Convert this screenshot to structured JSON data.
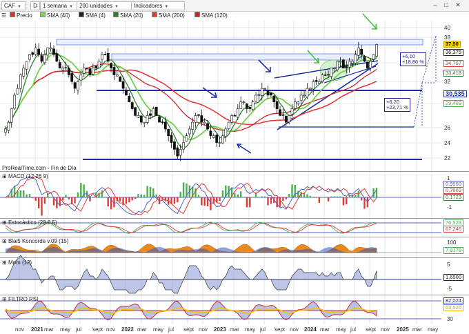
{
  "toolbar": {
    "symbol": "CAF",
    "mode_letter": "D",
    "period": "1 semana",
    "units": "200 unidades",
    "indicators": "Indicadores"
  },
  "legend": [
    {
      "label": "Precio",
      "color": "#d33333"
    },
    {
      "label": "SMA (40)",
      "color": "#7fd65a"
    },
    {
      "label": "SMA (4)",
      "color": "#222222"
    },
    {
      "label": "SMA (20)",
      "color": "#2e7d32"
    },
    {
      "label": "SMA (200)",
      "color": "#e53935"
    },
    {
      "label": "SMA (120)",
      "color": "#c62828"
    }
  ],
  "main_chart": {
    "source": "ProRealTime.com - Fin de Día",
    "y_ticks": [
      "40",
      "38",
      "34",
      "32",
      "30",
      "28",
      "26",
      "24",
      "22"
    ],
    "price_tags": [
      {
        "text": "37,50",
        "bg": "#ffd400",
        "fg": "#000000",
        "bc": "#c9a800"
      },
      {
        "text": "36,375",
        "bg": "#ffffff",
        "fg": "#000000",
        "bc": "#222222"
      },
      {
        "text": "34,797",
        "bg": "#ffffff",
        "fg": "#e53935",
        "bc": "#e53935"
      },
      {
        "text": "33,418",
        "bg": "#ffffff",
        "fg": "#2e7d32",
        "bc": "#2e7d32"
      },
      {
        "text": "30,535",
        "bg": "#ffffff",
        "fg": "#1a2fa8",
        "bc": "#1a2fa8"
      },
      {
        "text": "29,489",
        "bg": "#ffffff",
        "fg": "#4caf50",
        "bc": "#4caf50"
      }
    ],
    "box_top": [
      "+6,10",
      "+18,86 %"
    ],
    "box_bottom": [
      "+6,20",
      "+23,71 %"
    ],
    "closes": [
      25,
      26,
      28,
      30,
      31,
      33,
      34,
      35,
      36,
      36,
      37,
      36,
      35,
      36,
      37,
      37,
      36,
      35,
      34,
      34,
      34,
      33,
      32,
      31,
      32,
      33,
      34,
      34,
      33,
      34,
      34,
      35,
      36,
      36,
      35,
      34,
      33,
      33,
      32,
      31,
      30,
      29,
      28,
      27,
      27,
      26,
      26,
      27,
      27,
      28,
      27,
      26,
      26,
      25,
      24,
      23,
      22,
      21,
      22,
      23,
      24,
      25,
      26,
      27,
      27,
      26,
      26,
      25,
      24,
      24,
      23,
      23,
      24,
      25,
      26,
      27,
      27,
      28,
      29,
      29,
      28,
      28,
      29,
      30,
      30,
      31,
      31,
      30,
      30,
      29,
      28,
      27,
      27,
      26,
      27,
      28,
      29,
      29,
      30,
      30,
      31,
      31,
      32,
      32,
      32,
      33,
      33,
      33,
      34,
      34,
      35,
      35,
      34,
      34,
      35,
      35,
      36,
      37,
      36,
      35,
      34,
      35,
      36,
      37.5
    ]
  },
  "panels": {
    "macd": {
      "title": "MACD (12 26 9)",
      "values": [
        "0,9550",
        "0,7869",
        "0,1723"
      ],
      "ticks": [
        "1",
        "0",
        "-1"
      ]
    },
    "stoch": {
      "title": "Estocástico (28 8 5)",
      "values": [
        "76,528",
        "67,246"
      ]
    },
    "koncorde": {
      "title": "Blai5 Koncorde v.09 (15)",
      "values": [
        "7,8178"
      ],
      "ticks": [
        "100",
        "0",
        "-100"
      ]
    },
    "mom": {
      "title": "Mom (12)",
      "values": [
        "1,6500"
      ],
      "ticks": [
        "5",
        "0",
        "-5"
      ]
    },
    "rsi": {
      "title": "FILTRO RSI",
      "values": [
        "82,024",
        "63,520"
      ],
      "ticks": [
        "70",
        "30"
      ]
    }
  },
  "x_axis": [
    {
      "label": "nov",
      "year": false
    },
    {
      "label": "2021",
      "year": true
    },
    {
      "label": "mar",
      "year": false
    },
    {
      "label": "may",
      "year": false
    },
    {
      "label": "jul",
      "year": false
    },
    {
      "label": "sept",
      "year": false
    },
    {
      "label": "nov",
      "year": false
    },
    {
      "label": "2022",
      "year": true
    },
    {
      "label": "mar",
      "year": false
    },
    {
      "label": "may",
      "year": false
    },
    {
      "label": "jul",
      "year": false
    },
    {
      "label": "sept",
      "year": false
    },
    {
      "label": "nov",
      "year": false
    },
    {
      "label": "2023",
      "year": true
    },
    {
      "label": "mar",
      "year": false
    },
    {
      "label": "may",
      "year": false
    },
    {
      "label": "jul",
      "year": false
    },
    {
      "label": "sept",
      "year": false
    },
    {
      "label": "nov",
      "year": false
    },
    {
      "label": "2024",
      "year": true
    },
    {
      "label": "mar",
      "year": false
    },
    {
      "label": "may",
      "year": false
    },
    {
      "label": "jul",
      "year": false
    },
    {
      "label": "sept",
      "year": false
    },
    {
      "label": "nov",
      "year": false
    },
    {
      "label": "2025",
      "year": true
    },
    {
      "label": "mar",
      "year": false
    },
    {
      "label": "may",
      "year": false
    }
  ]
}
